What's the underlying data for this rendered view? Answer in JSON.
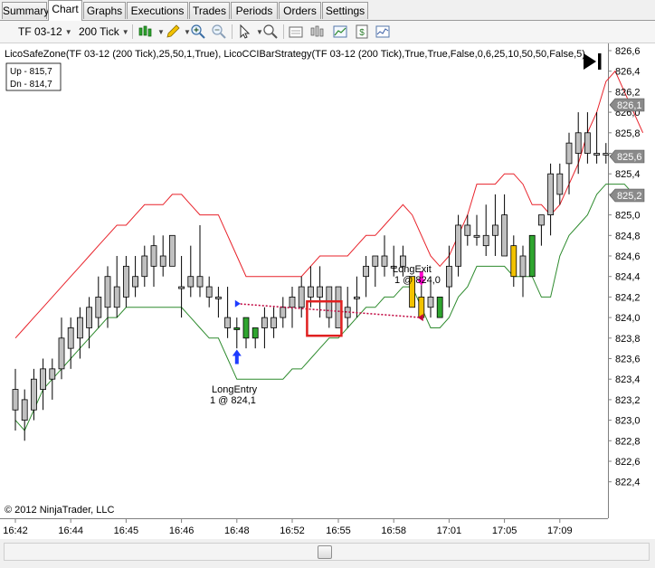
{
  "tabs": [
    {
      "label": "Summary",
      "active": false
    },
    {
      "label": "Chart",
      "active": true
    },
    {
      "label": "Graphs",
      "active": false
    },
    {
      "label": "Executions",
      "active": false
    },
    {
      "label": "Trades",
      "active": false
    },
    {
      "label": "Periods",
      "active": false
    },
    {
      "label": "Orders",
      "active": false
    },
    {
      "label": "Settings",
      "active": false
    }
  ],
  "toolbar": {
    "instrument": "TF 03-12",
    "interval": "200 Tick",
    "icons": [
      "bar-type-icon",
      "drawing-pencil-icon",
      "zoom-in-icon",
      "zoom-out-icon",
      "cursor-icon",
      "magnifier-icon",
      "data-box-icon",
      "bar-spacing-icon",
      "chart-properties-icon",
      "strategies-icon",
      "indicators-icon"
    ]
  },
  "chart_header": {
    "indicator_text": "LicoSafeZone(TF 03-12 (200 Tick),25,50,1,True), LicoCCIBarStrategy(TF 03-12 (200 Tick),True,True,False,0,6,25,10,50,50,False,5)",
    "legend_up": "Up - 815,7",
    "legend_dn": "Dn - 814,7",
    "copyright": "© 2012 NinjaTrader, LLC"
  },
  "markers": {
    "long_entry_line1": "LongEntry",
    "long_entry_line2": "1 @ 824,1",
    "long_exit_line1": "LongExit",
    "long_exit_line2": "1 @ 824,0"
  },
  "price_tags": {
    "upper": "826,1",
    "current": "825,6",
    "lower": "825,2"
  },
  "colors": {
    "red_line": "#e8222a",
    "green_line": "#2e8b2e",
    "bar_green": "#2fa52f",
    "bar_gold": "#f2c200",
    "bar_gray": "#c0c0c0",
    "trade_line": "#c0003c",
    "highlight_box": "#e02020",
    "entry_arrow": "#1e3cff",
    "exit_arrow": "#ff00cc"
  },
  "chart_data": {
    "type": "candlestick",
    "ylim": [
      822.3,
      826.7
    ],
    "y_ticks": [
      "826,6",
      "826,4",
      "826,2",
      "826,0",
      "825,8",
      "825,6",
      "825,4",
      "825,2",
      "825,0",
      "824,8",
      "824,6",
      "824,4",
      "824,2",
      "824,0",
      "823,8",
      "823,6",
      "823,4",
      "823,2",
      "823,0",
      "822,8",
      "822,6",
      "822,4"
    ],
    "x_ticks": [
      {
        "i": 0,
        "label": "16:42"
      },
      {
        "i": 6,
        "label": "16:44"
      },
      {
        "i": 12,
        "label": "16:45"
      },
      {
        "i": 18,
        "label": "16:46"
      },
      {
        "i": 24,
        "label": "16:48"
      },
      {
        "i": 30,
        "label": "16:52"
      },
      {
        "i": 35,
        "label": "16:55"
      },
      {
        "i": 41,
        "label": "16:58"
      },
      {
        "i": 47,
        "label": "17:01"
      },
      {
        "i": 53,
        "label": "17:05"
      },
      {
        "i": 59,
        "label": "17:09"
      }
    ],
    "bars": [
      {
        "o": 823.3,
        "h": 823.5,
        "l": 822.9,
        "c": 823.1,
        "col": "gray"
      },
      {
        "o": 823.0,
        "h": 823.3,
        "l": 822.8,
        "c": 823.2,
        "col": "gray"
      },
      {
        "o": 823.1,
        "h": 823.5,
        "l": 823.0,
        "c": 823.4,
        "col": "gray"
      },
      {
        "o": 823.3,
        "h": 823.6,
        "l": 823.1,
        "c": 823.5,
        "col": "gray"
      },
      {
        "o": 823.4,
        "h": 823.6,
        "l": 823.2,
        "c": 823.5,
        "col": "gray"
      },
      {
        "o": 823.5,
        "h": 824.0,
        "l": 823.4,
        "c": 823.8,
        "col": "gray"
      },
      {
        "o": 823.7,
        "h": 824.0,
        "l": 823.5,
        "c": 823.9,
        "col": "gray"
      },
      {
        "o": 823.8,
        "h": 824.1,
        "l": 823.6,
        "c": 824.0,
        "col": "gray"
      },
      {
        "o": 823.9,
        "h": 824.2,
        "l": 823.7,
        "c": 824.1,
        "col": "gray"
      },
      {
        "o": 824.0,
        "h": 824.4,
        "l": 823.9,
        "c": 824.2,
        "col": "gray"
      },
      {
        "o": 824.1,
        "h": 824.5,
        "l": 823.9,
        "c": 824.4,
        "col": "gray"
      },
      {
        "o": 824.3,
        "h": 824.6,
        "l": 824.0,
        "c": 824.1,
        "col": "gray"
      },
      {
        "o": 824.2,
        "h": 824.6,
        "l": 824.1,
        "c": 824.5,
        "col": "gray"
      },
      {
        "o": 824.4,
        "h": 824.6,
        "l": 824.2,
        "c": 824.3,
        "col": "gray"
      },
      {
        "o": 824.4,
        "h": 824.7,
        "l": 824.3,
        "c": 824.6,
        "col": "gray"
      },
      {
        "o": 824.5,
        "h": 824.8,
        "l": 824.3,
        "c": 824.7,
        "col": "gray"
      },
      {
        "o": 824.6,
        "h": 824.8,
        "l": 824.4,
        "c": 824.5,
        "col": "gray"
      },
      {
        "o": 824.8,
        "h": 824.8,
        "l": 824.5,
        "c": 824.5,
        "col": "gray"
      },
      {
        "o": 824.3,
        "h": 824.6,
        "l": 824.0,
        "c": 824.3,
        "col": "gray"
      },
      {
        "o": 824.4,
        "h": 824.7,
        "l": 824.2,
        "c": 824.3,
        "col": "gray"
      },
      {
        "o": 824.4,
        "h": 824.9,
        "l": 824.2,
        "c": 824.3,
        "col": "gray"
      },
      {
        "o": 824.3,
        "h": 824.4,
        "l": 824.1,
        "c": 824.2,
        "col": "gray"
      },
      {
        "o": 824.2,
        "h": 824.3,
        "l": 824.0,
        "c": 824.2,
        "col": "gray"
      },
      {
        "o": 824.0,
        "h": 824.3,
        "l": 823.8,
        "c": 823.9,
        "col": "gray"
      },
      {
        "o": 823.9,
        "h": 824.0,
        "l": 823.7,
        "c": 823.9,
        "col": "green"
      },
      {
        "o": 824.0,
        "h": 824.0,
        "l": 823.7,
        "c": 823.8,
        "col": "green"
      },
      {
        "o": 823.8,
        "h": 823.9,
        "l": 823.7,
        "c": 823.9,
        "col": "green"
      },
      {
        "o": 823.9,
        "h": 824.1,
        "l": 823.7,
        "c": 824.0,
        "col": "gray"
      },
      {
        "o": 823.9,
        "h": 824.1,
        "l": 823.8,
        "c": 824.0,
        "col": "gray"
      },
      {
        "o": 824.0,
        "h": 824.2,
        "l": 823.9,
        "c": 824.1,
        "col": "gray"
      },
      {
        "o": 824.1,
        "h": 824.3,
        "l": 823.9,
        "c": 824.2,
        "col": "gray"
      },
      {
        "o": 824.1,
        "h": 824.4,
        "l": 824.0,
        "c": 824.3,
        "col": "gray"
      },
      {
        "o": 824.3,
        "h": 824.5,
        "l": 824.1,
        "c": 824.2,
        "col": "gray"
      },
      {
        "o": 824.2,
        "h": 824.5,
        "l": 824.0,
        "c": 824.3,
        "col": "gray"
      },
      {
        "o": 824.3,
        "h": 824.3,
        "l": 823.9,
        "c": 824.0,
        "col": "gray"
      },
      {
        "o": 823.9,
        "h": 824.3,
        "l": 823.9,
        "c": 824.3,
        "col": "gray"
      },
      {
        "o": 824.1,
        "h": 824.3,
        "l": 823.9,
        "c": 824.0,
        "col": "gray"
      },
      {
        "o": 824.2,
        "h": 824.4,
        "l": 824.0,
        "c": 824.2,
        "col": "gray"
      },
      {
        "o": 824.4,
        "h": 824.6,
        "l": 824.2,
        "c": 824.5,
        "col": "gray"
      },
      {
        "o": 824.5,
        "h": 824.6,
        "l": 824.3,
        "c": 824.6,
        "col": "gray"
      },
      {
        "o": 824.6,
        "h": 824.8,
        "l": 824.4,
        "c": 824.5,
        "col": "gray"
      },
      {
        "o": 824.5,
        "h": 824.7,
        "l": 824.4,
        "c": 824.5,
        "col": "gray"
      },
      {
        "o": 824.6,
        "h": 824.7,
        "l": 824.4,
        "c": 824.5,
        "col": "gray"
      },
      {
        "o": 824.4,
        "h": 824.4,
        "l": 824.1,
        "c": 824.1,
        "col": "gold"
      },
      {
        "o": 824.2,
        "h": 824.4,
        "l": 824.0,
        "c": 824.0,
        "col": "gold"
      },
      {
        "o": 824.2,
        "h": 824.4,
        "l": 824.0,
        "c": 824.1,
        "col": "gray"
      },
      {
        "o": 824.0,
        "h": 824.2,
        "l": 824.0,
        "c": 824.2,
        "col": "green"
      },
      {
        "o": 824.3,
        "h": 824.7,
        "l": 824.1,
        "c": 824.5,
        "col": "gray"
      },
      {
        "o": 824.5,
        "h": 825.0,
        "l": 824.4,
        "c": 824.9,
        "col": "gray"
      },
      {
        "o": 824.9,
        "h": 825.0,
        "l": 824.7,
        "c": 824.8,
        "col": "gray"
      },
      {
        "o": 824.8,
        "h": 825.0,
        "l": 824.7,
        "c": 824.8,
        "col": "gray"
      },
      {
        "o": 824.8,
        "h": 825.1,
        "l": 824.6,
        "c": 824.7,
        "col": "gray"
      },
      {
        "o": 824.8,
        "h": 825.2,
        "l": 824.6,
        "c": 824.9,
        "col": "gray"
      },
      {
        "o": 825.0,
        "h": 825.2,
        "l": 824.6,
        "c": 824.6,
        "col": "gray"
      },
      {
        "o": 824.7,
        "h": 824.8,
        "l": 824.3,
        "c": 824.4,
        "col": "gold"
      },
      {
        "o": 824.6,
        "h": 824.7,
        "l": 824.2,
        "c": 824.4,
        "col": "gray"
      },
      {
        "o": 824.4,
        "h": 824.8,
        "l": 824.4,
        "c": 824.8,
        "col": "green"
      },
      {
        "o": 824.9,
        "h": 825.0,
        "l": 824.7,
        "c": 825.0,
        "col": "gray"
      },
      {
        "o": 825.0,
        "h": 825.5,
        "l": 824.8,
        "c": 825.4,
        "col": "gray"
      },
      {
        "o": 825.2,
        "h": 825.5,
        "l": 825.1,
        "c": 825.4,
        "col": "gray"
      },
      {
        "o": 825.5,
        "h": 825.8,
        "l": 825.2,
        "c": 825.7,
        "col": "gray"
      },
      {
        "o": 825.6,
        "h": 826.0,
        "l": 825.4,
        "c": 825.8,
        "col": "gray"
      },
      {
        "o": 825.8,
        "h": 826.0,
        "l": 825.5,
        "c": 825.6,
        "col": "gray"
      },
      {
        "o": 825.6,
        "h": 826.0,
        "l": 825.5,
        "c": 825.6,
        "col": "gray"
      },
      {
        "o": 825.6,
        "h": 825.7,
        "l": 825.5,
        "c": 825.6,
        "col": "gray"
      }
    ],
    "red_line": [
      823.8,
      823.9,
      824.0,
      824.1,
      824.2,
      824.3,
      824.4,
      824.5,
      824.6,
      824.7,
      824.8,
      824.9,
      824.9,
      825.0,
      825.1,
      825.1,
      825.1,
      825.2,
      825.2,
      825.1,
      825.0,
      825.0,
      825.0,
      824.8,
      824.6,
      824.4,
      824.4,
      824.4,
      824.4,
      824.4,
      824.4,
      824.4,
      824.5,
      824.6,
      824.6,
      824.6,
      824.6,
      824.7,
      824.8,
      824.8,
      824.9,
      825.0,
      825.1,
      825.0,
      824.8,
      824.6,
      824.5,
      824.6,
      824.8,
      825.0,
      825.3,
      825.3,
      825.3,
      825.4,
      825.4,
      825.3,
      825.1,
      825.1,
      825.0,
      825.1,
      825.3,
      825.5,
      825.8,
      826.0,
      826.3,
      826.4,
      826.2,
      826.0,
      825.8
    ],
    "green_line": [
      823.0,
      822.9,
      823.1,
      823.3,
      823.4,
      823.5,
      823.6,
      823.7,
      823.8,
      823.9,
      824.0,
      824.0,
      824.1,
      824.1,
      824.1,
      824.1,
      824.1,
      824.1,
      824.1,
      824.0,
      823.9,
      823.8,
      823.8,
      823.6,
      823.4,
      823.4,
      823.4,
      823.4,
      823.4,
      823.4,
      823.5,
      823.5,
      823.6,
      823.7,
      823.8,
      823.8,
      823.9,
      824.0,
      824.1,
      824.1,
      824.2,
      824.2,
      824.3,
      824.3,
      824.1,
      823.9,
      823.9,
      824.0,
      824.2,
      824.3,
      824.5,
      824.5,
      824.5,
      824.5,
      824.4,
      824.4,
      824.4,
      824.2,
      824.2,
      824.6,
      824.8,
      824.9,
      825.0,
      825.2,
      825.3,
      825.3,
      825.3,
      825.2,
      825.2
    ]
  }
}
